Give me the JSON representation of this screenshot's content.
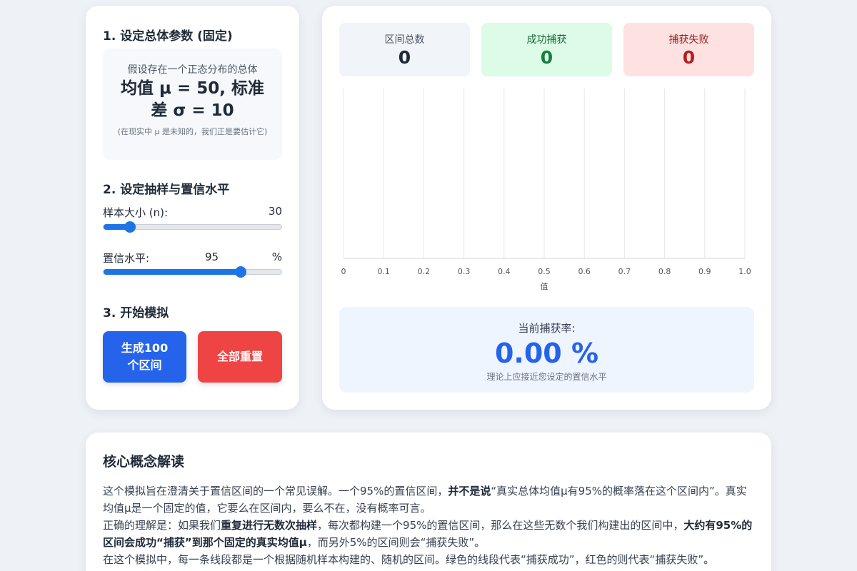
{
  "setup": {
    "population_title": "1. 设定总体参数 (固定)",
    "population_intro": "假设存在一个正态分布的总体",
    "population_params": "均值 μ = 50, 标准差 σ = 10",
    "population_note": "(在现实中 μ 是未知的，我们正是要估计它)",
    "sampling_title": "2. 设定抽样与置信水平",
    "sample_size_label": "样本大小 (n):",
    "sample_size_value": "30",
    "sample_size_fraction": 0.15,
    "confidence_label": "置信水平:",
    "confidence_value": "95",
    "confidence_unit": "%",
    "confidence_fraction": 0.77,
    "run_title": "3. 开始模拟",
    "generate_button": "生成100个区间",
    "reset_button": "全部重置"
  },
  "stats": {
    "total_label": "区间总数",
    "total_value": "0",
    "success_label": "成功捕获",
    "success_value": "0",
    "fail_label": "捕获失败",
    "fail_value": "0"
  },
  "capture_rate": {
    "label": "当前捕获率:",
    "value": "0.00 %",
    "note": "理论上应接近您设定的置信水平"
  },
  "chart_data": {
    "type": "scatter",
    "title": "",
    "xlabel": "值",
    "ylabel": "",
    "xlim": [
      0,
      1
    ],
    "x_ticks": [
      "0",
      "0.1",
      "0.2",
      "0.3",
      "0.4",
      "0.5",
      "0.6",
      "0.7",
      "0.8",
      "0.9",
      "1.0"
    ],
    "grid": true,
    "series": []
  },
  "concept": {
    "title": "核心概念解读",
    "p1_a": "这个模拟旨在澄清关于置信区间的一个常见误解。一个95%的置信区间，",
    "p1_b": "并不是说",
    "p1_c": "“真实总体均值μ有95%的概率落在这个区间内”。真实均值μ是一个固定的值，它要么在区间内，要么不在，没有概率可言。",
    "p2_a": "正确的理解是：如果我们",
    "p2_b": "重复进行无数次抽样",
    "p2_c": "，每次都构建一个95%的置信区间，那么在这些无数个我们构建出的区间中，",
    "p2_d": "大约有95%的区间会成功“捕获”到那个固定的真实均值μ",
    "p2_e": "，而另外5%的区间则会“捕获失败”。",
    "p3": "在这个模拟中，每一条线段都是一个根据随机样本构建的、随机的区间。绿色的线段代表“捕获成功”，红色的则代表“捕获失败”。"
  },
  "colors": {
    "accent": "#2563eb",
    "success": "#15803d",
    "fail": "#ef4444",
    "slider": "#1d74e6"
  }
}
